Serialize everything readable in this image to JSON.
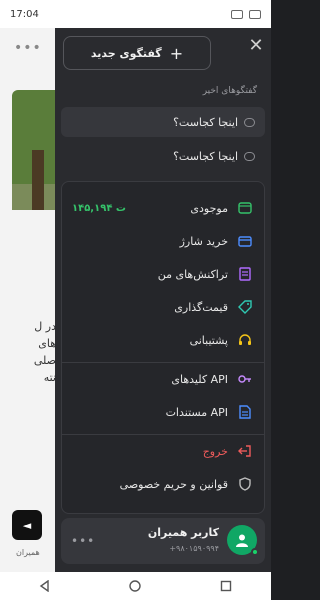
{
  "status_bar": {
    "time": "17:04"
  },
  "background": {
    "partial_text": "در ل های صلی نته",
    "button_glyph": "◄",
    "caption": "همیران"
  },
  "drawer": {
    "new_chat_label": "گفتگوی جدید",
    "recent_title": "گفتگوهای اخیر",
    "conversations": [
      {
        "label": "اینجا کجاست؟"
      },
      {
        "label": "اینجا کجاست؟"
      }
    ],
    "menu": {
      "wallet": {
        "label": "موجودی",
        "balance": "۱۴۵,۱۹۴ ت"
      },
      "recharge": {
        "label": "خرید شارژ"
      },
      "transactions": {
        "label": "تراکنش‌های من"
      },
      "pricing": {
        "label": "قیمت‌گذاری"
      },
      "support": {
        "label": "پشتیبانی"
      },
      "api_keys": {
        "label": "کلیدهای API"
      },
      "api_docs": {
        "label": "مستندات API"
      },
      "logout": {
        "label": "خروج"
      },
      "privacy": {
        "label": "قوانین و حریم خصوصی"
      }
    },
    "user": {
      "name": "کاربر همیران",
      "phone": "+۹۸۰۱۵۹۰۹۹۴"
    }
  },
  "colors": {
    "accent_green": "#10a765",
    "balance_green": "#35c26a",
    "logout_red": "#ef5b5b"
  }
}
